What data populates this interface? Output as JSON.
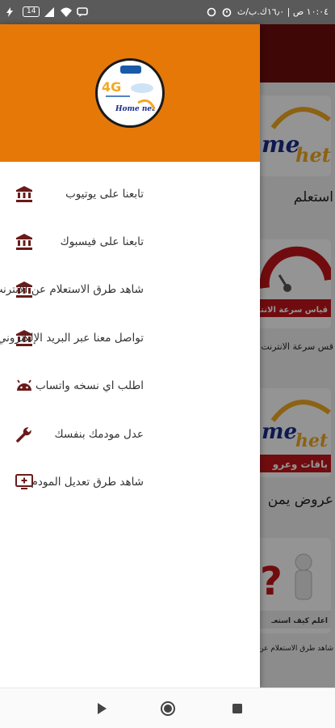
{
  "status_bar": {
    "time": "١٠:٠٤ ص | ١٦٫٠ك.ب/ث",
    "battery": "14"
  },
  "background_app": {
    "captions": [
      "استعلم",
      "قس سرعة الانترنت",
      "عروض يمن",
      "شاهد طرق الاستعلام عن"
    ],
    "card_texts": [
      "me",
      "het",
      "قياس سرعة الانتـ",
      "باقات وعرو",
      "اعلم كيف استعـ"
    ]
  },
  "drawer": {
    "logo_text": [
      "4G",
      "Home net"
    ],
    "menu": [
      {
        "label": "تابعنا على يوتيوب",
        "icon": "bank-icon"
      },
      {
        "label": "تابعنا على فيسبوك",
        "icon": "bank-icon"
      },
      {
        "label": "شاهد طرق الاستعلام عن الانترنت",
        "icon": "bank-icon"
      },
      {
        "label": "تواصل معنا عبر البريد الإلكتروني",
        "icon": "bank-icon"
      },
      {
        "label": "اطلب اي نسخه واتساب",
        "icon": "android-icon"
      },
      {
        "label": "عدل مودمك بنفسك",
        "icon": "wrench-icon"
      },
      {
        "label": "شاهد طرق تعديل المودم",
        "icon": "monitor-add-icon"
      }
    ]
  },
  "colors": {
    "header": "#e67808",
    "toolbar": "#6e0d0d",
    "icon": "#6b1a1a"
  }
}
